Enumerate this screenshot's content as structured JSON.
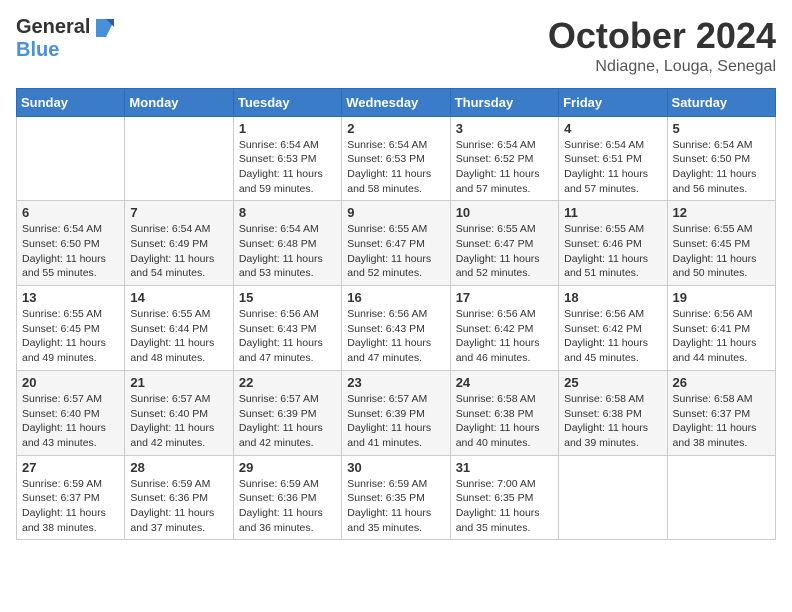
{
  "logo": {
    "general": "General",
    "blue": "Blue"
  },
  "title": {
    "month": "October 2024",
    "location": "Ndiagne, Louga, Senegal"
  },
  "days_of_week": [
    "Sunday",
    "Monday",
    "Tuesday",
    "Wednesday",
    "Thursday",
    "Friday",
    "Saturday"
  ],
  "weeks": [
    [
      {
        "day": "",
        "info": ""
      },
      {
        "day": "",
        "info": ""
      },
      {
        "day": "1",
        "info": "Sunrise: 6:54 AM\nSunset: 6:53 PM\nDaylight: 11 hours and 59 minutes."
      },
      {
        "day": "2",
        "info": "Sunrise: 6:54 AM\nSunset: 6:53 PM\nDaylight: 11 hours and 58 minutes."
      },
      {
        "day": "3",
        "info": "Sunrise: 6:54 AM\nSunset: 6:52 PM\nDaylight: 11 hours and 57 minutes."
      },
      {
        "day": "4",
        "info": "Sunrise: 6:54 AM\nSunset: 6:51 PM\nDaylight: 11 hours and 57 minutes."
      },
      {
        "day": "5",
        "info": "Sunrise: 6:54 AM\nSunset: 6:50 PM\nDaylight: 11 hours and 56 minutes."
      }
    ],
    [
      {
        "day": "6",
        "info": "Sunrise: 6:54 AM\nSunset: 6:50 PM\nDaylight: 11 hours and 55 minutes."
      },
      {
        "day": "7",
        "info": "Sunrise: 6:54 AM\nSunset: 6:49 PM\nDaylight: 11 hours and 54 minutes."
      },
      {
        "day": "8",
        "info": "Sunrise: 6:54 AM\nSunset: 6:48 PM\nDaylight: 11 hours and 53 minutes."
      },
      {
        "day": "9",
        "info": "Sunrise: 6:55 AM\nSunset: 6:47 PM\nDaylight: 11 hours and 52 minutes."
      },
      {
        "day": "10",
        "info": "Sunrise: 6:55 AM\nSunset: 6:47 PM\nDaylight: 11 hours and 52 minutes."
      },
      {
        "day": "11",
        "info": "Sunrise: 6:55 AM\nSunset: 6:46 PM\nDaylight: 11 hours and 51 minutes."
      },
      {
        "day": "12",
        "info": "Sunrise: 6:55 AM\nSunset: 6:45 PM\nDaylight: 11 hours and 50 minutes."
      }
    ],
    [
      {
        "day": "13",
        "info": "Sunrise: 6:55 AM\nSunset: 6:45 PM\nDaylight: 11 hours and 49 minutes."
      },
      {
        "day": "14",
        "info": "Sunrise: 6:55 AM\nSunset: 6:44 PM\nDaylight: 11 hours and 48 minutes."
      },
      {
        "day": "15",
        "info": "Sunrise: 6:56 AM\nSunset: 6:43 PM\nDaylight: 11 hours and 47 minutes."
      },
      {
        "day": "16",
        "info": "Sunrise: 6:56 AM\nSunset: 6:43 PM\nDaylight: 11 hours and 47 minutes."
      },
      {
        "day": "17",
        "info": "Sunrise: 6:56 AM\nSunset: 6:42 PM\nDaylight: 11 hours and 46 minutes."
      },
      {
        "day": "18",
        "info": "Sunrise: 6:56 AM\nSunset: 6:42 PM\nDaylight: 11 hours and 45 minutes."
      },
      {
        "day": "19",
        "info": "Sunrise: 6:56 AM\nSunset: 6:41 PM\nDaylight: 11 hours and 44 minutes."
      }
    ],
    [
      {
        "day": "20",
        "info": "Sunrise: 6:57 AM\nSunset: 6:40 PM\nDaylight: 11 hours and 43 minutes."
      },
      {
        "day": "21",
        "info": "Sunrise: 6:57 AM\nSunset: 6:40 PM\nDaylight: 11 hours and 42 minutes."
      },
      {
        "day": "22",
        "info": "Sunrise: 6:57 AM\nSunset: 6:39 PM\nDaylight: 11 hours and 42 minutes."
      },
      {
        "day": "23",
        "info": "Sunrise: 6:57 AM\nSunset: 6:39 PM\nDaylight: 11 hours and 41 minutes."
      },
      {
        "day": "24",
        "info": "Sunrise: 6:58 AM\nSunset: 6:38 PM\nDaylight: 11 hours and 40 minutes."
      },
      {
        "day": "25",
        "info": "Sunrise: 6:58 AM\nSunset: 6:38 PM\nDaylight: 11 hours and 39 minutes."
      },
      {
        "day": "26",
        "info": "Sunrise: 6:58 AM\nSunset: 6:37 PM\nDaylight: 11 hours and 38 minutes."
      }
    ],
    [
      {
        "day": "27",
        "info": "Sunrise: 6:59 AM\nSunset: 6:37 PM\nDaylight: 11 hours and 38 minutes."
      },
      {
        "day": "28",
        "info": "Sunrise: 6:59 AM\nSunset: 6:36 PM\nDaylight: 11 hours and 37 minutes."
      },
      {
        "day": "29",
        "info": "Sunrise: 6:59 AM\nSunset: 6:36 PM\nDaylight: 11 hours and 36 minutes."
      },
      {
        "day": "30",
        "info": "Sunrise: 6:59 AM\nSunset: 6:35 PM\nDaylight: 11 hours and 35 minutes."
      },
      {
        "day": "31",
        "info": "Sunrise: 7:00 AM\nSunset: 6:35 PM\nDaylight: 11 hours and 35 minutes."
      },
      {
        "day": "",
        "info": ""
      },
      {
        "day": "",
        "info": ""
      }
    ]
  ]
}
